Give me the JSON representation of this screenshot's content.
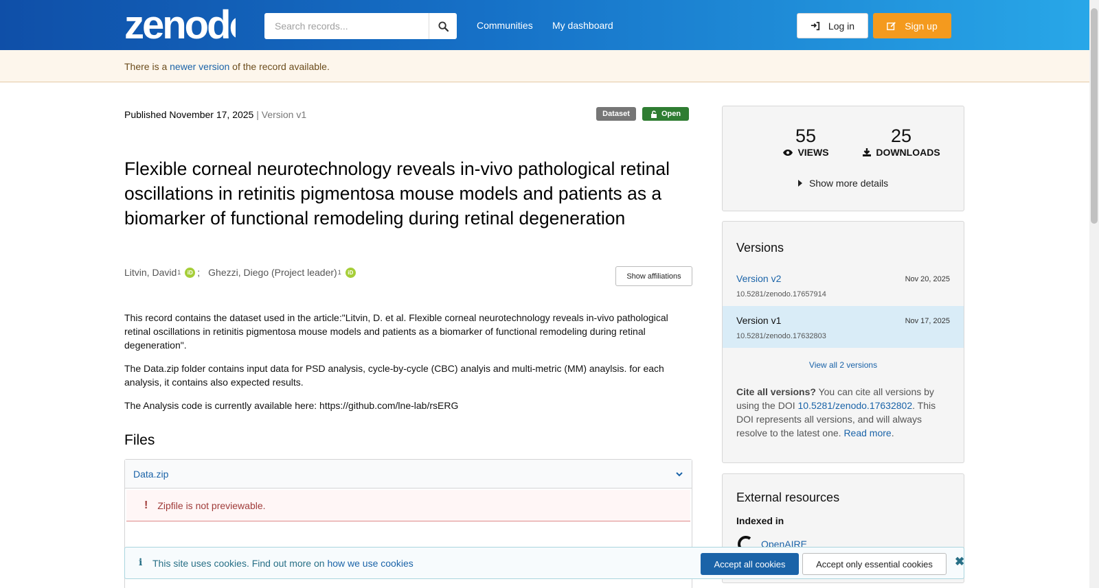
{
  "header": {
    "logo_text": "zenodo",
    "search_placeholder": "Search records...",
    "nav": [
      "Communities",
      "My dashboard"
    ],
    "login_label": "Log in",
    "signup_label": "Sign up"
  },
  "notice": {
    "prefix": "There is a ",
    "link": "newer version",
    "suffix": " of the record available."
  },
  "record": {
    "published": "Published November 17, 2025",
    "version_sep": " | Version v1",
    "badge_type": "Dataset",
    "badge_access": "Open",
    "title": "Flexible corneal neurotechnology reveals in-vivo pathological retinal oscillations in retinitis pigmentosa mouse models and patients as a biomarker of functional remodeling during retinal degeneration",
    "authors": [
      {
        "name": "Litvin, David",
        "aff": "1",
        "sep": ";"
      },
      {
        "name": "Ghezzi, Diego (Project leader)",
        "aff": "1",
        "sep": ""
      }
    ],
    "show_affiliations": "Show affiliations",
    "description": [
      "This record contains the dataset used in the article:\"Litvin, D. et al. Flexible corneal neurotechnology reveals in-vivo pathological retinal oscillations in retinitis pigmentosa mouse models and patients as a biomarker of functional remodeling during retinal degeneration\".",
      "The Data.zip folder contains input data for PSD analysis, cycle-by-cycle (CBC) analyis and multi-metric (MM) anaylsis. for each analysis, it contains also expected results.",
      "The Analysis code is currently available here: https://github.com/lne-lab/rsERG"
    ],
    "files_heading": "Files",
    "file_name": "Data.zip",
    "file_error": "Zipfile is not previewable."
  },
  "stats": {
    "views": "55",
    "views_label": "VIEWS",
    "downloads": "25",
    "downloads_label": "DOWNLOADS",
    "more_details": "Show more details"
  },
  "versions": {
    "heading": "Versions",
    "items": [
      {
        "name": "Version v2",
        "date": "Nov 20, 2025",
        "doi": "10.5281/zenodo.17657914"
      },
      {
        "name": "Version v1",
        "date": "Nov 17, 2025",
        "doi": "10.5281/zenodo.17632803"
      }
    ],
    "view_all": "View all 2 versions",
    "cite_bold": "Cite all versions?",
    "cite_text1": " You can cite all versions by using the DOI ",
    "cite_doi": "10.5281/zenodo.17632802",
    "cite_text2": ". This DOI represents all versions, and will always resolve to the latest one. ",
    "read_more": "Read more",
    "cite_end": "."
  },
  "external": {
    "heading": "External resources",
    "indexed_in": "Indexed in",
    "openaire": "OpenAIRE"
  },
  "cookie": {
    "prefix": "This site uses cookies. Find out more on ",
    "link": "how we use cookies",
    "accept_all": "Accept all cookies",
    "accept_essential": "Accept only essential cookies"
  }
}
